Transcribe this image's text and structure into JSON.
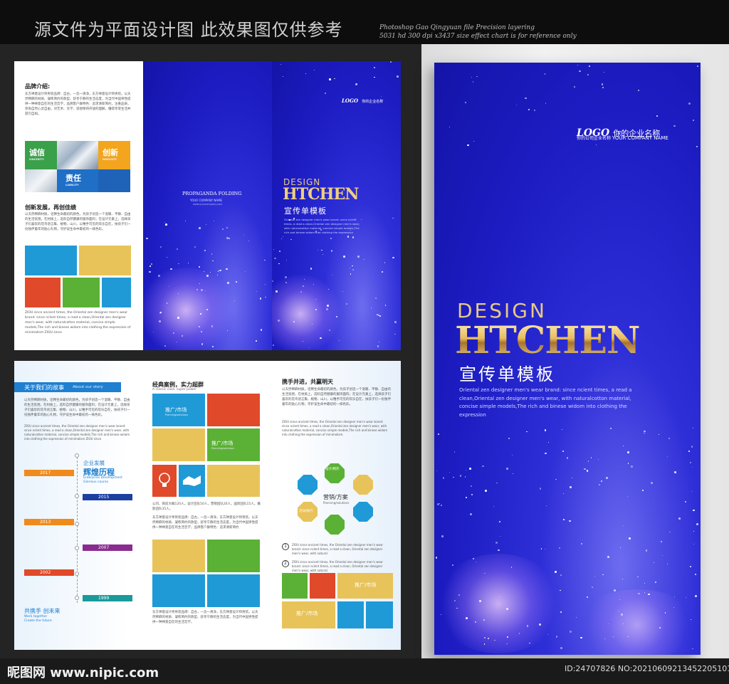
{
  "banner": {
    "title_cn": "源文件为平面设计图 此效果图仅供参考",
    "title_en_line1": "Photoshop Gao Qingyuan file Precision layering",
    "title_en_line2": "5031 hd 300 dpi x3437 size effect chart is for reference only"
  },
  "inner_top": {
    "brand_heading": "品牌介绍:",
    "brand_text": "东方禅意设计师男装品牌：自古，一念一清净，东方禅意设计师男装。以天然棉麻的材质、凝练简约的款型、舒享宁静的生活态度，为当代中国男性提供一种禅意自在的生活哲学，品牌客户群特色：追求清新简约，注重品质，崇尚自然心灵自由，对艺术、文学、思想保持开放的理解，懂得享受生活并游刃自如。",
    "tile_1_cn": "诚信",
    "tile_1_en": "SINCERITY",
    "tile_2_cn": "创新",
    "tile_2_en": "INNOVATE",
    "tile_3_cn": "责任",
    "tile_3_en": "LIABILITY",
    "innovation_heading": "创新发展，再创佳绩",
    "innovation_text": "以天然棉麻材质，诠释生命最初的颜色，为孩子创造一个温暖、平静、自由的生活氛围，在材质上，选料自然健康的服饰面料；在设计元素上，选择孩子们喜欢的花鸟语言集、植物、山川，以稚手可见的欢乐自在，扶孩子们一份独伴童年的贴心礼物，守护该生命中最初的一抹色彩。",
    "bottom_text": "ZIOU since ancient times, the Oriental zen designer men's wear brand: since nclent times, a read a clean,Oriental zen designer men's wear, with naturalcotton material, concise simple models,The rich and binese widom into clothing the expression of minimalism ZIOU since",
    "middle_title": "PROPAGANDA FOLDING",
    "middle_sub": "YOUR COMPANY NAME",
    "middle_sub2": "www.yourcompany.com",
    "logo_text": "LOGO",
    "logo_cn": "你的企业名称",
    "small_design": "DESIGN",
    "small_htchen": "HTCHEN",
    "small_title_cn": "宣传单模板",
    "small_desc": "Oriental zen designer men's wear brand: since ncient times, a read a clean,Oriental zen designer men's wear, with naturalcotton material, concise simple models,The rich and binese widom into clothing the expression"
  },
  "inner_bottom": {
    "story_heading": "关于我们的故事",
    "story_heading_en": "About our story",
    "story_text": "以天然棉麻材质，诠释生命最初的颜色，为孩子创造一个温暖、平静、自由的生活氛围，在材质上，选料自然健康的服饰面料；在设计元素上，选择孩子们喜欢的花鸟语言集、植物、山川，以稚手可见的欢乐自在，扶孩子们一份独伴童年的贴心礼物，守护该生命中最初的一抹色彩。",
    "story_text_en": "ZIOU since ancient times, the Oriental zen designer men's wear brand: since nclent times, a read a clean,Oriental zen designer men's wear, with naturalcotton material, concise simple models,The rich and binese widom into clothing the expression of minimalism ZIOU since",
    "timeline_heading1": "企业发展",
    "timeline_heading2": "辉煌历程",
    "timeline_sub_en1": "Enterprise Development",
    "timeline_sub_en2": "Glorious course",
    "years": [
      "2017",
      "2015",
      "2013",
      "2007",
      "2002",
      "1999"
    ],
    "future_cn": "共携手 创未来",
    "future_en1": "Work together",
    "future_en2": "Create the future",
    "case_heading": "经典案例，实力超群",
    "case_heading_en": "A classic case, super power",
    "tile_promo": "推广/市场",
    "tile_promo_en": "Planning/solutions",
    "case_text": "公司、目前大概120人，设计团队50人，营销团队20人，国际团队15人，摄影团队35人。",
    "case_text2": "东方禅意设计师男装品牌：自古，一念一清净，东方禅意设计师男装。以天然棉麻的材质、凝练简约的款型、舒享宁静的生活态度，为当代中国男性提供一种禅意自在的生活哲学，品牌客户群特色：追求清新简约",
    "case_text3": "东方禅意设计师男装品牌：自古，一念一清净，东方禅意设计师男装。以天然棉麻的材质、凝练简约的款型、舒享宁静的生活态度，为当代中国男性提供一种禅意自在的生活哲学。",
    "win_heading": "携手并进，共赢明天",
    "win_text": "以天然棉麻材质，诠释生命最初的颜色，为孩子创造一个温暖、平静、自由的生活氛围，在材质上，选料自然健康的服饰面料；在设计元素上，选择孩子们喜欢的花鸟语言集、植物、山川，以稚手可见的欢乐自在，扶孩子们一份独伴童年的贴心礼物，守护该生命中最初的一抹色彩。",
    "win_text_en": "ZIOU since ancient times, the Oriental zen designer men's wear brand: since nclent times, a read a clean,Oriental zen designer men's wear, with naturalcotton material, concise simple models,The rich and binese widom into clothing the expression of minimalism.",
    "oct_top": "设计/制作",
    "oct_center": "营销/方案",
    "oct_center_en": "Planning/solutions",
    "oct_left": "活动/执行",
    "point_1": "1",
    "point_2": "2",
    "point_text": "ZIOU since ancient times, the Oriental zen designer men's wear brand: since nclent times, a read a clean, Oriental zen designer men's wear, with natural",
    "tile_promo2": "推广/市场",
    "tile_promo3": "推广/市场"
  },
  "cover": {
    "logo_text": "LOGO",
    "logo_cn": "你的企业名称",
    "logo_sub_cn": "你的公司企业名称",
    "logo_sub_en": "YOUR COMPANY NAME",
    "design": "DESIGN",
    "htchen": "HTCHEN",
    "title_cn": "宣传单模板",
    "desc": "Oriental zen designer men's wear brand: since ncient times, a read a clean,Oriental zen designer men's wear, with naturalcotton material, concise simple models,The rich and binese widom into clothing the expression"
  },
  "footer": {
    "site": "昵图网 www.nipic.com",
    "id": "ID:24707826 NO:20210609213452205101"
  },
  "colors": {
    "blue": "#1f9ad6",
    "yellow": "#e8c35a",
    "red": "#e0492a",
    "green": "#5bb136",
    "navy": "#1c1cc2",
    "orange": "#f08a1c",
    "purple": "#8a2c8f"
  }
}
